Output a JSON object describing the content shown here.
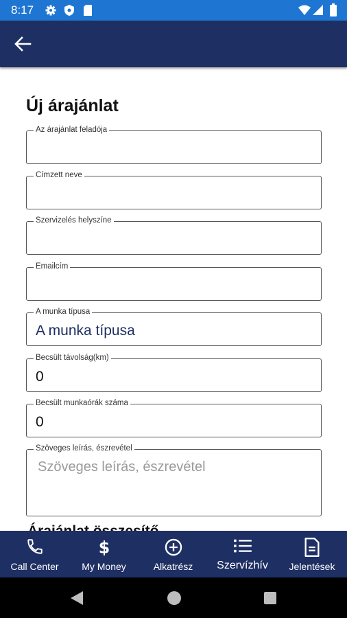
{
  "status_bar": {
    "time": "8:17"
  },
  "page": {
    "title": "Új árajánlat"
  },
  "form": {
    "fields": [
      {
        "label": "Az árajánlat feladója",
        "value": ""
      },
      {
        "label": "Címzett neve",
        "value": ""
      },
      {
        "label": "Szervizelés helyszíne",
        "value": ""
      },
      {
        "label": "Emailcím",
        "value": ""
      },
      {
        "label": "A munka típusa",
        "value": "A munka típusa"
      },
      {
        "label": "Becsült távolság(km)",
        "value": "0"
      },
      {
        "label": "Becsült munkaórák száma",
        "value": "0"
      },
      {
        "label": "Szöveges leírás, észrevétel",
        "value": "",
        "placeholder": "Szöveges leírás, észrevétel"
      }
    ],
    "next_section_partial": "Árajánlat összesítő"
  },
  "bottom_nav": {
    "items": [
      {
        "label": "Call Center",
        "icon": "phone-icon"
      },
      {
        "label": "My Money",
        "icon": "dollar-icon"
      },
      {
        "label": "Alkatrész",
        "icon": "add-circle-icon"
      },
      {
        "label": "Szervízhív",
        "icon": "list-icon",
        "active": true
      },
      {
        "label": "Jelentések",
        "icon": "document-icon"
      }
    ]
  },
  "colors": {
    "status_bar": "#1f76d2",
    "app_bar": "#1e2f63",
    "accent_text": "#1e2f63"
  }
}
